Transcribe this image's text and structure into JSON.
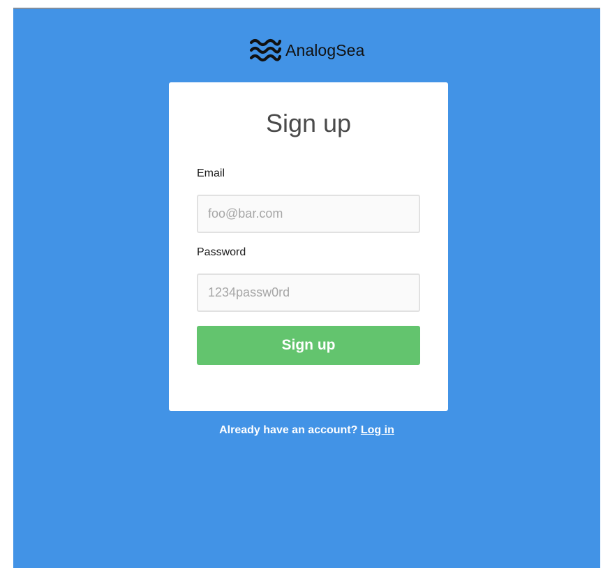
{
  "brand": {
    "name": "AnalogSea",
    "logo_icon": "waves-icon"
  },
  "signup": {
    "title": "Sign up",
    "email_label": "Email",
    "email_placeholder": "foo@bar.com",
    "password_label": "Password",
    "password_placeholder": "1234passw0rd",
    "submit_label": "Sign up"
  },
  "footer": {
    "prompt": "Already have an account?",
    "login_link": "Log in"
  },
  "colors": {
    "background": "#4293e6",
    "card": "#ffffff",
    "button": "#63c46e",
    "button_text": "#ffffff"
  }
}
